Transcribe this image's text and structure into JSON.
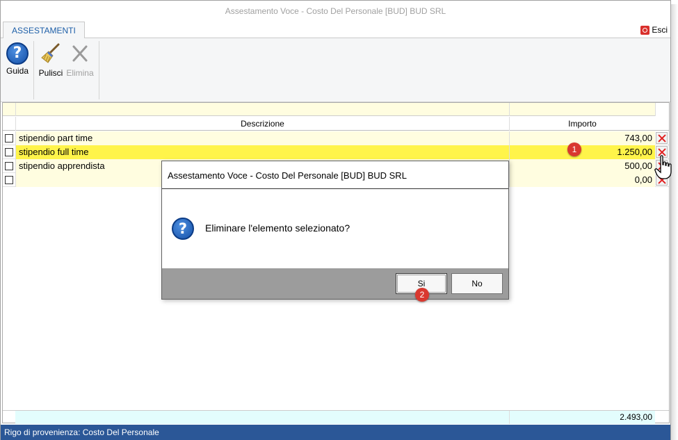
{
  "window": {
    "title": "Assestamento Voce - Costo Del Personale [BUD] BUD SRL"
  },
  "tabs": [
    {
      "label": "ASSESTAMENTI",
      "active": true
    }
  ],
  "esci": {
    "label": "Esci",
    "icon": "power-icon"
  },
  "ribbon": {
    "guida": {
      "label": "Guida",
      "icon": "help-icon"
    },
    "pulisci": {
      "label": "Pulisci",
      "icon": "broom-icon"
    },
    "elimina": {
      "label": "Elimina",
      "icon": "close-x-icon",
      "disabled": true
    }
  },
  "grid": {
    "columns": [
      "Descrizione",
      "Importo"
    ],
    "rows": [
      {
        "descrizione": "stipendio part time",
        "importo": "743,00",
        "selected": false
      },
      {
        "descrizione": "stipendio full time",
        "importo": "1.250,00",
        "selected": true
      },
      {
        "descrizione": "stipendio apprendista",
        "importo": "500,00",
        "selected": false
      },
      {
        "descrizione": "",
        "importo": "0,00",
        "selected": false
      }
    ],
    "total": "2.493,00"
  },
  "status": {
    "text": "Rigo di provenienza: Costo Del Personale"
  },
  "dialog": {
    "title": "Assestamento Voce - Costo Del Personale [BUD] BUD SRL",
    "message": "Eliminare l'elemento selezionato?",
    "yes_label": "Si",
    "no_label": "No"
  },
  "badges": {
    "one": "1",
    "two": "2"
  },
  "colors": {
    "accent": "#2b5797",
    "row_bg": "#fffde0",
    "selected_row": "#fff44a",
    "total_bg": "#e3fdfd",
    "badge": "#d9382f"
  }
}
